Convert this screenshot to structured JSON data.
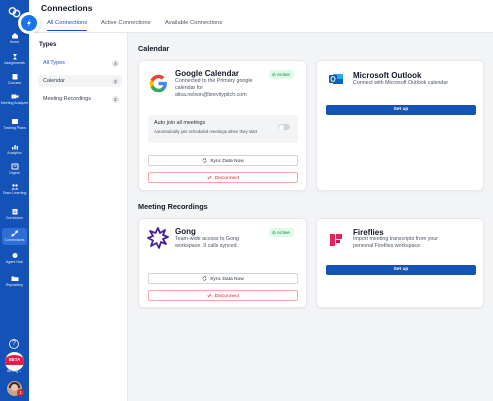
{
  "header": {
    "title": "Connections",
    "tabs": [
      {
        "label": "All Connections",
        "active": true
      },
      {
        "label": "Active Connections",
        "active": false
      },
      {
        "label": "Available Connections",
        "active": false
      }
    ]
  },
  "sidebar": {
    "items": [
      {
        "label": "Home",
        "icon": "home-icon"
      },
      {
        "label": "Assignments",
        "icon": "assignments-icon"
      },
      {
        "label": "Courses",
        "icon": "courses-icon"
      },
      {
        "label": "Meeting Analyzer",
        "icon": "video-icon"
      },
      {
        "label": "Training Plans",
        "icon": "training-icon"
      },
      {
        "label": "Analytics",
        "icon": "analytics-icon"
      },
      {
        "label": "Digest",
        "icon": "digest-icon"
      },
      {
        "label": "Team Learning",
        "icon": "team-icon"
      },
      {
        "label": "Curriculum",
        "icon": "curriculum-icon"
      },
      {
        "label": "Connections",
        "icon": "connections-icon"
      },
      {
        "label": "Agent Hub",
        "icon": "agent-icon"
      },
      {
        "label": "Repository",
        "icon": "folder-icon"
      }
    ],
    "help_glyph": "?",
    "org_badge": "BETA",
    "org_label": "All Org ⌄",
    "notification_count": "1"
  },
  "types": {
    "title": "Types",
    "items": [
      {
        "label": "All Types",
        "count": "4"
      },
      {
        "label": "Calendar",
        "count": "2"
      },
      {
        "label": "Meeting Recordings",
        "count": "2"
      }
    ]
  },
  "calendar": {
    "title": "Calendar",
    "google": {
      "name": "Google Calendar",
      "status": "Active",
      "desc1": "Connected to the Primary google",
      "desc2": "calendar for",
      "desc3": "alisa.nelson@brevitypitch.com",
      "autojoin_title": "Auto join all meetings",
      "autojoin_desc": "Automatically join scheduled meetings when they start",
      "autojoin_enabled": false,
      "sync_label": "Sync Data Now",
      "disconnect_label": "Disconnect"
    },
    "outlook": {
      "name": "Microsoft Outlook",
      "desc": "Connect with Microsoft Outlook calendar",
      "setup_label": "Set up"
    }
  },
  "recordings": {
    "title": "Meeting Recordings",
    "gong": {
      "name": "Gong",
      "status": "Active",
      "desc1": "Team-wide access to Gong",
      "desc2": "workspace. 9 calls synced.",
      "sync_label": "Sync Data Now",
      "disconnect_label": "Disconnect"
    },
    "fireflies": {
      "name": "Fireflies",
      "desc1": "Import meeting transcripts from your",
      "desc2": "personal Fireflies workspace",
      "setup_label": "Set up"
    }
  },
  "colors": {
    "sidebar": "#1552b8",
    "accent": "#1d4ed8",
    "active_badge": "#15803d",
    "danger": "#dc2626"
  }
}
